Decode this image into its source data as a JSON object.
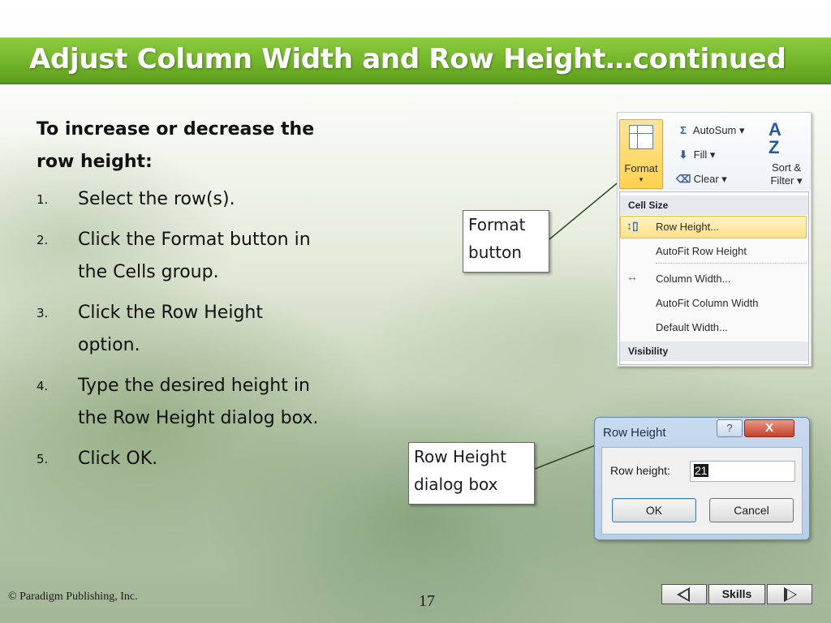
{
  "slide": {
    "title": "Adjust Column Width and Row Height…continued",
    "page_number": "17",
    "copyright": "© Paradigm Publishing, Inc.",
    "accent_color": "#72b42a"
  },
  "content": {
    "heading_line1": "To increase or decrease the",
    "heading_line2": "row height:",
    "steps": [
      {
        "num": "1.",
        "text": "Select the row(s)."
      },
      {
        "num": "2.",
        "line1": "Click the Format button in",
        "line2": "the Cells group."
      },
      {
        "num": "3.",
        "line1": "Click the Row Height",
        "line2": "option."
      },
      {
        "num": "4.",
        "line1": "Type the desired height in",
        "line2": "the Row Height dialog box."
      },
      {
        "num": "5.",
        "text": "Click OK."
      }
    ]
  },
  "callouts": {
    "format_line1": "Format",
    "format_line2": "button",
    "rowheight_line1": "Row Height",
    "rowheight_line2": "dialog box"
  },
  "ribbon": {
    "format_label": "Format",
    "autosum_label": "AutoSum ▾",
    "fill_label": "Fill ▾",
    "clear_label": "Clear ▾",
    "sort_line1": "Sort &",
    "sort_line2": "Filter ▾",
    "menu": {
      "section_cell_size": "Cell Size",
      "row_height": "Row Height...",
      "autofit_row_height": "AutoFit Row Height",
      "column_width": "Column Width...",
      "autofit_column_width": "AutoFit Column Width",
      "default_width": "Default Width...",
      "section_visibility": "Visibility"
    }
  },
  "dialog": {
    "title": "Row Height",
    "help_glyph": "?",
    "close_glyph": "X",
    "field_label": "Row height:",
    "field_value": "21",
    "ok_label": "OK",
    "cancel_label": "Cancel"
  },
  "nav": {
    "skills_label": "Skills"
  }
}
